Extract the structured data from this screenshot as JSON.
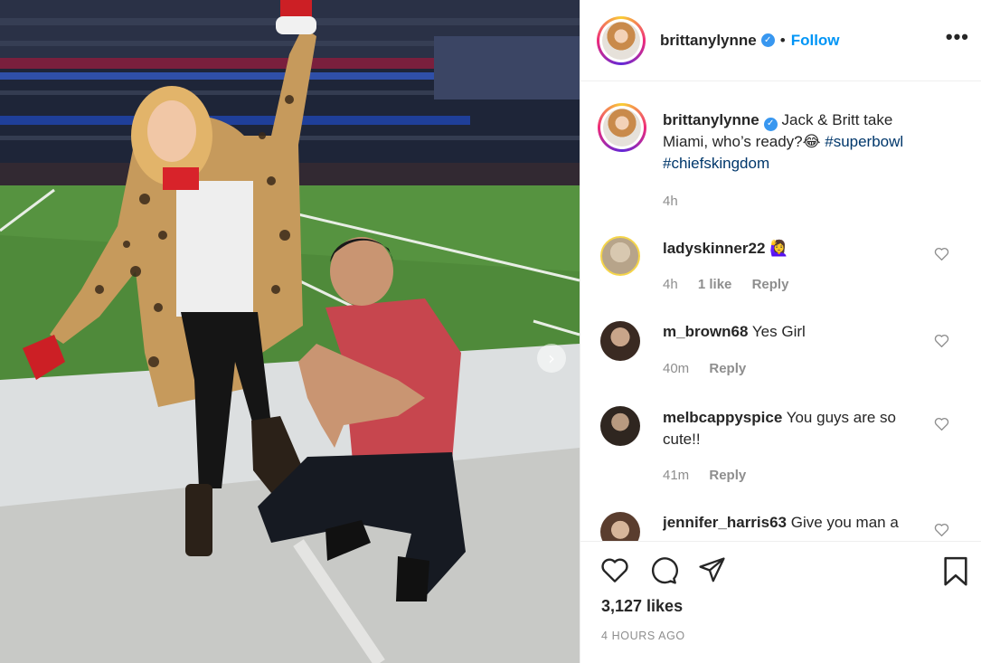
{
  "post": {
    "username": "brittanylynne",
    "verified_icon": "verified-badge-icon",
    "separator": "•",
    "follow_label": "Follow",
    "more_label": "•••",
    "carousel_next": "›"
  },
  "caption": {
    "username": "brittanylynne",
    "text": "Jack & Britt take Miami, who’s ready?😂",
    "hashtag1": "#superbowl",
    "hashtag2": "#chiefskingdom",
    "time": "4h"
  },
  "comments": [
    {
      "username": "ladyskinner22",
      "text": "🙋‍♀️",
      "time": "4h",
      "likes": "1 like",
      "reply": "Reply"
    },
    {
      "username": "m_brown68",
      "text": "Yes Girl",
      "time": "40m",
      "reply": "Reply"
    },
    {
      "username": "melbcappyspice",
      "text": "You guys are so cute!!",
      "time": "41m",
      "reply": "Reply"
    },
    {
      "username": "jennifer_harris63",
      "text": "Give you man a"
    }
  ],
  "footer": {
    "likes": "3,127 likes",
    "time_ago": "4 HOURS AGO"
  },
  "colors": {
    "link": "#00376b",
    "follow": "#0095f6",
    "muted": "#8e8e8e",
    "verified": "#3897f0"
  }
}
